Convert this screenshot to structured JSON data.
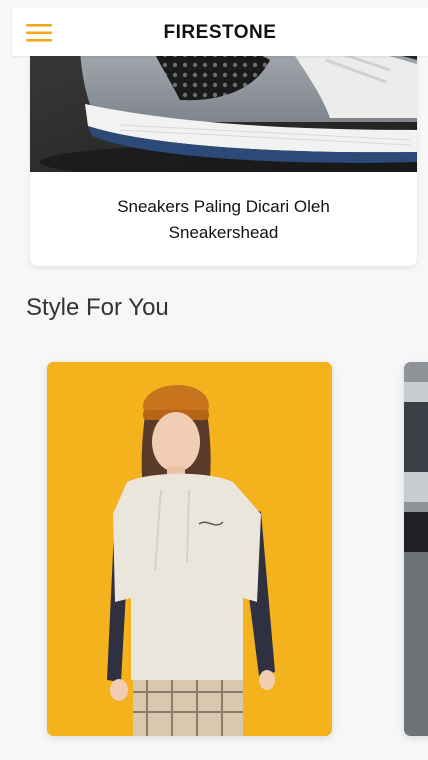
{
  "header": {
    "title": "FIRESTONE",
    "menu_icon": "hamburger-menu-icon"
  },
  "featured": {
    "caption_line1": "Sneakers Paling Dicari Oleh",
    "caption_line2": "Sneakershead"
  },
  "section": {
    "title": "Style For You"
  },
  "colors": {
    "accent": "#F0A81C",
    "card_background": "#FFFFFF",
    "page_background": "#F7F7F7",
    "style_card_yellow": "#F4B21C"
  }
}
